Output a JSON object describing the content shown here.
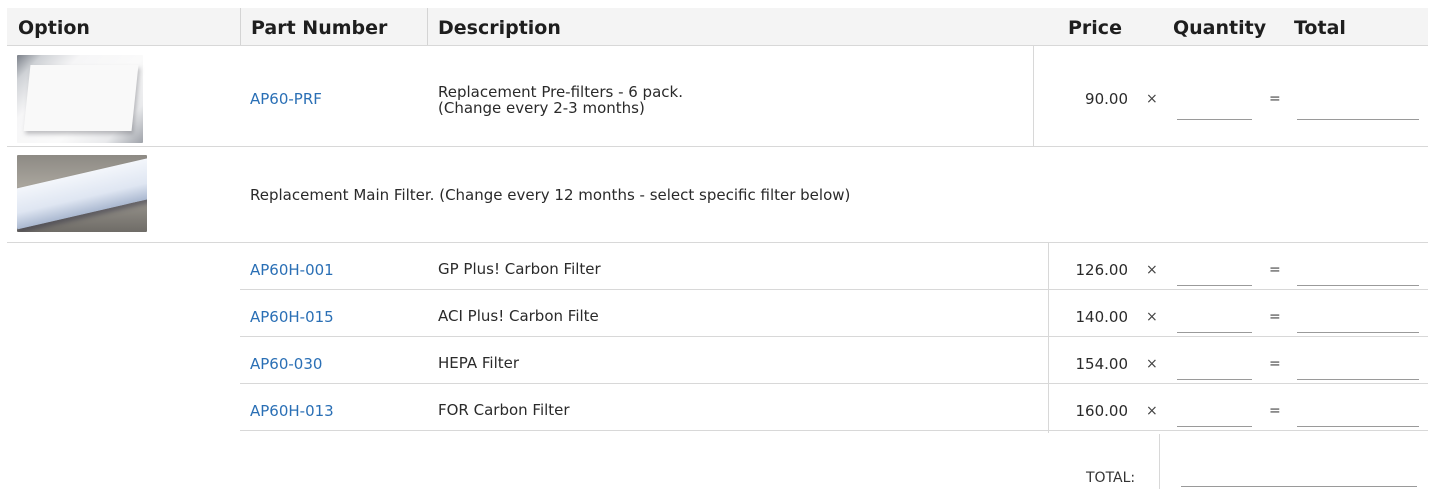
{
  "header": {
    "option": "Option",
    "part_number": "Part Number",
    "description": "Description",
    "price": "Price",
    "quantity": "Quantity",
    "total": "Total"
  },
  "prefilter": {
    "part": "AP60-PRF",
    "desc_line1": "Replacement Pre-filters - 6 pack.",
    "desc_line2": "(Change every 2-3 months)",
    "price": "90.00"
  },
  "main_filter_note": "Replacement Main Filter. (Change every 12 months - select specific filter below)",
  "filters": [
    {
      "part": "AP60H-001",
      "desc": "GP Plus! Carbon Filter",
      "price": "126.00"
    },
    {
      "part": "AP60H-015",
      "desc": "ACI Plus! Carbon Filte",
      "price": "140.00"
    },
    {
      "part": "AP60-030",
      "desc": "HEPA Filter",
      "price": "154.00"
    },
    {
      "part": "AP60H-013",
      "desc": "FOR Carbon Filter",
      "price": "160.00"
    }
  ],
  "symbols": {
    "times": "×",
    "equals": "="
  },
  "total_label": "TOTAL:",
  "colors": {
    "link": "#2a6fb5",
    "header_bg": "#f4f4f4",
    "rule": "#d8d8d8"
  }
}
